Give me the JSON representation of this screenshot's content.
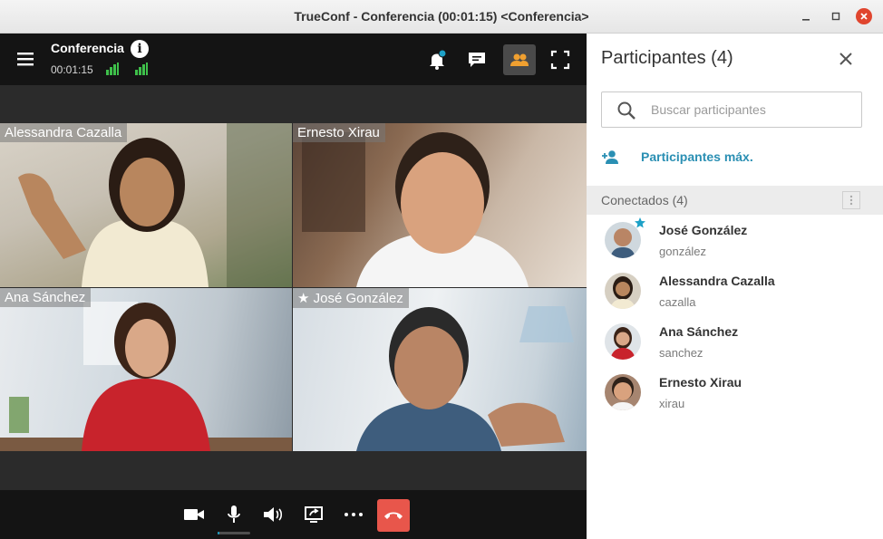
{
  "window": {
    "title": "TrueConf - Conferencia (00:01:15) <Conferencia>"
  },
  "topbar": {
    "conference_name": "Conferencia",
    "timer": "00:01:15"
  },
  "tiles": [
    {
      "name": "Alessandra Cazalla",
      "skin": "#b8865e",
      "hair": "#2a1c14",
      "shirt": "#f2ead2"
    },
    {
      "name": "Ernesto Xirau",
      "skin": "#d9a27e",
      "hair": "#2e2119",
      "shirt": "#f5f5f5"
    },
    {
      "name": "Ana Sánchez",
      "skin": "#d9a888",
      "hair": "#3b2418",
      "shirt": "#c8232c"
    },
    {
      "name": "★ José González",
      "skin": "#b98565",
      "hair": "#2a2a2a",
      "shirt": "#3e5d7d"
    }
  ],
  "controls": {
    "mic_level": 0.06
  },
  "panel": {
    "title": "Participantes (4)",
    "search_placeholder": "Buscar participantes",
    "max_label": "Participantes máx.",
    "section_label": "Conectados (4)",
    "participants": [
      {
        "name": "José González",
        "login": "gonzález",
        "owner": true,
        "skin": "#b98565",
        "bg": "#cfd8de"
      },
      {
        "name": "Alessandra Cazalla",
        "login": "cazalla",
        "owner": false,
        "skin": "#b8865e",
        "bg": "#d6cfc2"
      },
      {
        "name": "Ana Sánchez",
        "login": "sanchez",
        "owner": false,
        "skin": "#d9a888",
        "bg": "#dfe4e8"
      },
      {
        "name": "Ernesto Xirau",
        "login": "xirau",
        "owner": false,
        "skin": "#d9a27e",
        "bg": "#a68570"
      }
    ]
  },
  "colors": {
    "accent": "#2a8fb3",
    "hangup": "#e8564b",
    "signal": "#3ec04a",
    "notification_dot": "#1da1c7"
  }
}
